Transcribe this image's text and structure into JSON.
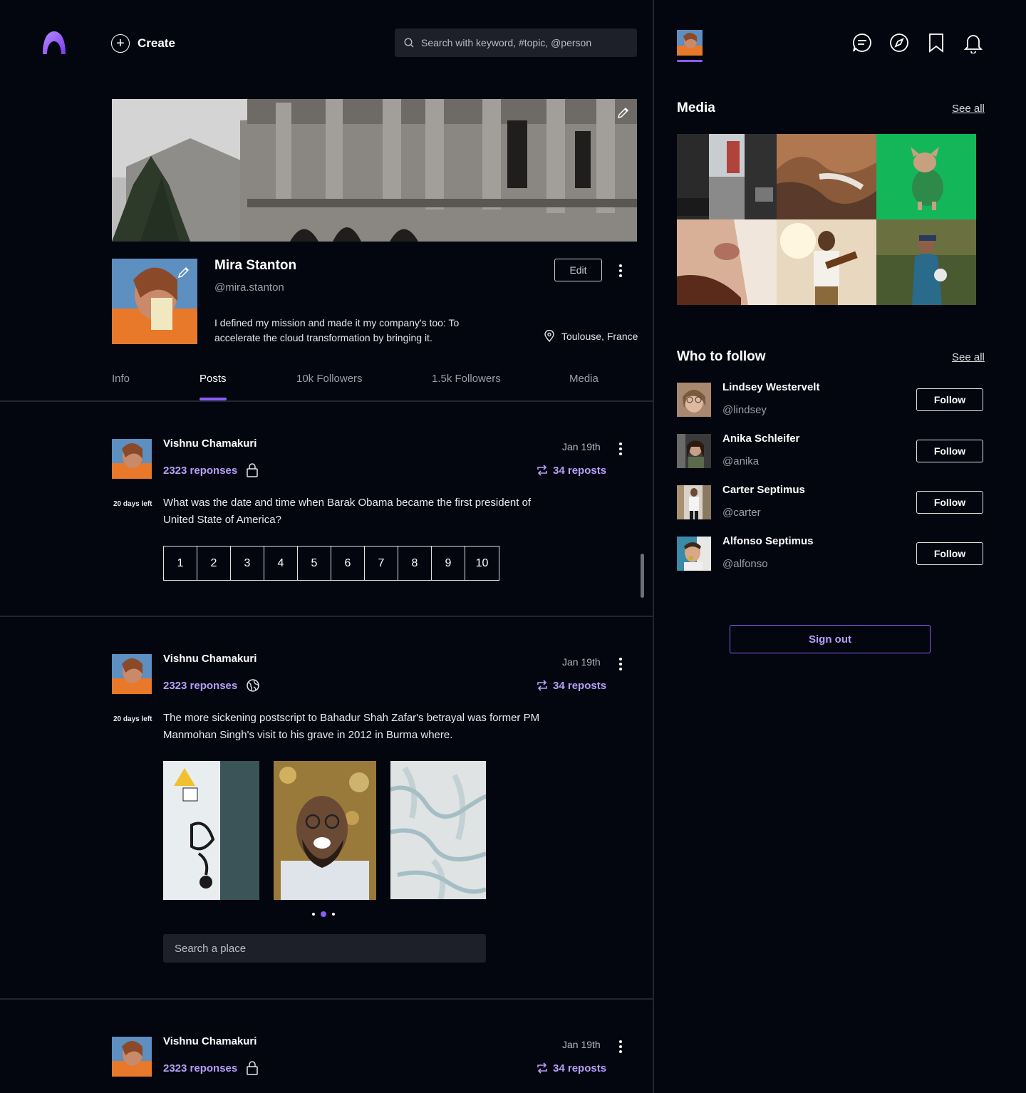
{
  "header": {
    "create_label": "Create",
    "search_placeholder": "Search with keyword, #topic, @person"
  },
  "profile": {
    "name": "Mira Stanton",
    "handle": "@mira.stanton",
    "bio": "I defined my mission and made it my company's too: To accelerate the cloud transformation by bringing it.",
    "edit_label": "Edit",
    "location": "Toulouse, France"
  },
  "tabs": [
    {
      "label": "Info"
    },
    {
      "label": "Posts",
      "active": true
    },
    {
      "label": "10k Followers"
    },
    {
      "label": "1.5k Followers"
    },
    {
      "label": "Media"
    }
  ],
  "posts": [
    {
      "author": "Vishnu Chamakuri",
      "responses": "2323 reponses",
      "date": "Jan 19th",
      "reposts": "34 reposts",
      "days_left": "20 days left",
      "text": "What was the date and time when Barak Obama became the first president of United State of America?",
      "scale": [
        "1",
        "2",
        "3",
        "4",
        "5",
        "6",
        "7",
        "8",
        "9",
        "10"
      ]
    },
    {
      "author": "Vishnu Chamakuri",
      "responses": "2323 reponses",
      "date": "Jan 19th",
      "reposts": "34 reposts",
      "days_left": "20 days left",
      "text": "The more sickening postscript to Bahadur Shah Zafar's betrayal was former PM Manmohan Singh's visit to his grave in 2012 in Burma where.",
      "place_placeholder": "Search a place"
    },
    {
      "author": "Vishnu Chamakuri",
      "responses": "2323 reponses",
      "date": "Jan 19th",
      "reposts": "34 reposts"
    }
  ],
  "sidebar": {
    "media_title": "Media",
    "media_see_all": "See all",
    "wtf_title": "Who to follow",
    "wtf_see_all": "See all",
    "follow_label": "Follow",
    "people": [
      {
        "name": "Lindsey Westervelt",
        "handle": "@lindsey"
      },
      {
        "name": "Anika Schleifer",
        "handle": "@anika"
      },
      {
        "name": "Carter Septimus",
        "handle": "@carter"
      },
      {
        "name": "Alfonso Septimus",
        "handle": "@alfonso"
      }
    ],
    "signout_label": "Sign out"
  },
  "colors": {
    "background": "#04060f",
    "accent": "#8b5cf6",
    "accent_text": "#b79ef7"
  },
  "icons": [
    "logo-icon",
    "plus-icon",
    "search-icon",
    "pencil-icon",
    "more-vertical-icon",
    "map-pin-icon",
    "lock-icon",
    "globe-icon",
    "repost-icon",
    "message-icon",
    "compass-icon",
    "bookmark-icon",
    "bell-icon"
  ]
}
